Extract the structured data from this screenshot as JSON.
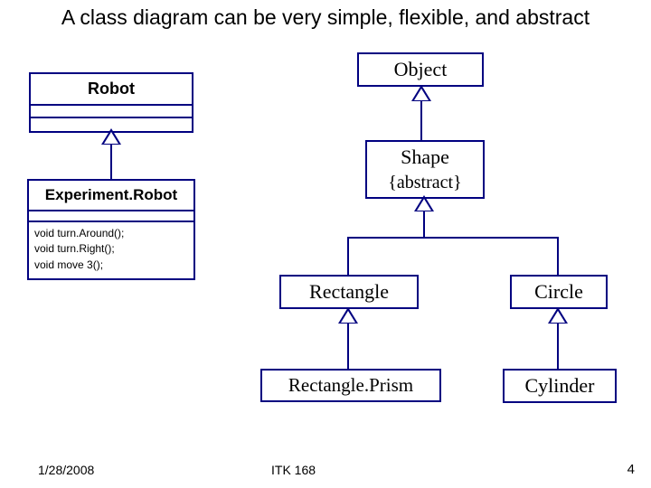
{
  "title": "A class diagram can be very simple, flexible, and abstract",
  "classes": {
    "robot": {
      "name": "Robot"
    },
    "experimentRobot": {
      "name": "Experiment.Robot",
      "methods": "void turn.Around();\nvoid turn.Right();\nvoid move 3();"
    },
    "object": {
      "name": "Object"
    },
    "shape": {
      "name": "Shape",
      "constraint": "{abstract}"
    },
    "rectangle": {
      "name": "Rectangle"
    },
    "circle": {
      "name": "Circle"
    },
    "rectanglePrism": {
      "name": "Rectangle.Prism"
    },
    "cylinder": {
      "name": "Cylinder"
    }
  },
  "footer": {
    "date": "1/28/2008",
    "course": "ITK 168",
    "page": "4"
  },
  "chart_data": {
    "type": "table",
    "diagram": "uml-class",
    "relationships": [
      {
        "child": "Experiment.Robot",
        "parent": "Robot",
        "kind": "generalization"
      },
      {
        "child": "Shape",
        "parent": "Object",
        "kind": "generalization"
      },
      {
        "child": "Rectangle",
        "parent": "Shape",
        "kind": "generalization"
      },
      {
        "child": "Circle",
        "parent": "Shape",
        "kind": "generalization"
      },
      {
        "child": "Rectangle.Prism",
        "parent": "Rectangle",
        "kind": "generalization"
      },
      {
        "child": "Cylinder",
        "parent": "Circle",
        "kind": "generalization"
      }
    ],
    "classes": [
      {
        "name": "Robot",
        "methods": []
      },
      {
        "name": "Experiment.Robot",
        "methods": [
          "void turn.Around();",
          "void turn.Right();",
          "void move 3();"
        ]
      },
      {
        "name": "Object"
      },
      {
        "name": "Shape",
        "constraint": "{abstract}"
      },
      {
        "name": "Rectangle"
      },
      {
        "name": "Circle"
      },
      {
        "name": "Rectangle.Prism"
      },
      {
        "name": "Cylinder"
      }
    ]
  }
}
